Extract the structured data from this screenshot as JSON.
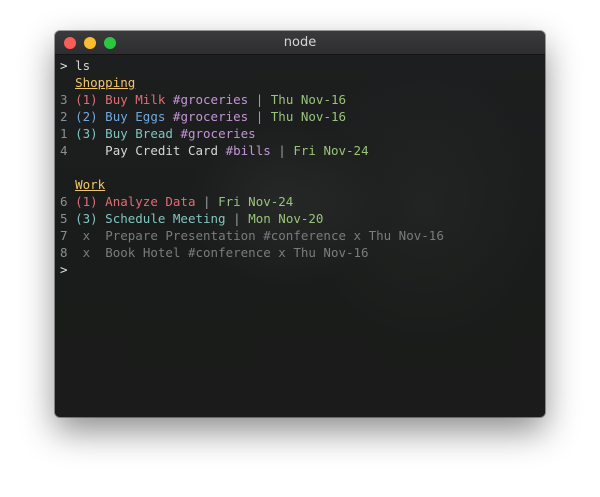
{
  "window": {
    "title": "node"
  },
  "terminal": {
    "prompt": ">",
    "command": "ls",
    "sections": [
      {
        "header": "Shopping",
        "items": [
          {
            "num": "3",
            "priority": "(1)",
            "text": "Buy Milk",
            "tag": "#groceries",
            "sep": "|",
            "date": "Thu Nov-16",
            "color": "red"
          },
          {
            "num": "2",
            "priority": "(2)",
            "text": "Buy Eggs",
            "tag": "#groceries",
            "sep": "|",
            "date": "Thu Nov-16",
            "color": "blue"
          },
          {
            "num": "1",
            "priority": "(3)",
            "text": "Buy Bread",
            "tag": "#groceries",
            "sep": "",
            "date": "",
            "color": "cyan"
          },
          {
            "num": "4",
            "priority": "",
            "text": "Pay Credit Card",
            "tag": "#bills",
            "sep": "|",
            "date": "Fri Nov-24",
            "color": "plain"
          }
        ]
      },
      {
        "header": "Work",
        "items": [
          {
            "num": "6",
            "priority": "(1)",
            "text": "Analyze Data",
            "tag": "",
            "sep": "|",
            "date": "Fri Nov-24",
            "color": "red"
          },
          {
            "num": "5",
            "priority": "(3)",
            "text": "Schedule Meeting",
            "tag": "",
            "sep": "|",
            "date": "Mon Nov-20",
            "color": "cyan"
          }
        ],
        "completed": [
          {
            "num": "7",
            "mark": "x",
            "text": "Prepare Presentation #conference x Thu Nov-16"
          },
          {
            "num": "8",
            "mark": "x",
            "text": "Book Hotel #conference x Thu Nov-16"
          }
        ]
      }
    ],
    "end_prompt": ">"
  },
  "colors": {
    "red": "#e06c75",
    "blue": "#6fa8dc",
    "cyan": "#7fc5c0",
    "green": "#98c379",
    "purple": "#c395d6",
    "header": "#f0c66c"
  }
}
